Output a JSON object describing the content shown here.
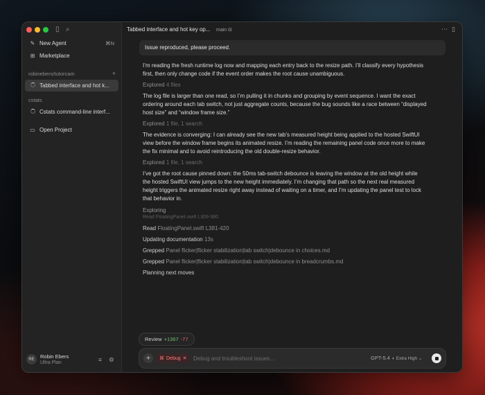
{
  "colors": {
    "traffic_red": "#ff5f57",
    "traffic_yellow": "#febc2e",
    "traffic_green": "#28c840",
    "diff_add": "#6fbf73",
    "diff_del": "#e06464",
    "debug_chip": "#ff7a7a"
  },
  "sidebar": {
    "toolbar_icons": [
      "sidebar-toggle-icon",
      "search-icon"
    ],
    "new_agent": {
      "label": "New Agent",
      "shortcut": "⌘N"
    },
    "marketplace": {
      "label": "Marketplace"
    },
    "sections": [
      {
        "name": "robinebers/tutorcam",
        "items": [
          {
            "label": "Tabbed interface and hot k..."
          }
        ]
      },
      {
        "name": "cstats",
        "items": [
          {
            "label": "Cstats command-line interf..."
          }
        ]
      }
    ],
    "open_project": {
      "label": "Open Project"
    },
    "user": {
      "initials": "RE",
      "name": "Robin Ebers",
      "plan": "Ultra Plan"
    }
  },
  "header": {
    "title": "Tabbed interface and hot key op...",
    "branch": "main"
  },
  "conversation": {
    "user_prompt": "Issue reproduced, please proceed.",
    "messages": [
      "I’m reading the fresh runtime log now and mapping each entry back to the resize path. I’ll classify every hypothesis first, then only change code if the event order makes the root cause unambiguous.",
      "The log file is larger than one read, so I’m pulling it in chunks and grouping by event sequence. I want the exact ordering around each tab switch, not just aggregate counts, because the bug sounds like a race between “displayed host size” and “window frame size.”",
      "The evidence is converging: I can already see the new tab’s measured height being applied to the hosted SwiftUI view before the window frame begins its animated resize. I’m reading the remaining panel code once more to make the fix minimal and to avoid reintroducing the old double-resize behavior.",
      "I’ve got the root cause pinned down: the 50ms tab-switch debounce is leaving the window at the old height while the hosted SwiftUI view jumps to the new height immediately. I’m changing that path so the next real measured height triggers the animated resize right away instead of waiting on a timer, and I’m updating the panel test to lock that behavior in."
    ],
    "explored": [
      {
        "verb": "Explored",
        "detail": "4 files"
      },
      {
        "verb": "Explored",
        "detail": "1 file, 1 search"
      },
      {
        "verb": "Explored",
        "detail": "1 file, 1 search"
      }
    ],
    "exploring_label": "Exploring",
    "faded_line": "Read FloatingPanel.swift L309-380",
    "activities": [
      {
        "verb": "Read",
        "detail": "FloatingPanel.swift L381-420"
      },
      {
        "verb": "Updating documentation",
        "detail": "13s"
      },
      {
        "verb": "Grepped",
        "detail": "Panel flicker|flicker stabilization|tab switch|debounce in choices.md"
      },
      {
        "verb": "Grepped",
        "detail": "Panel flicker|flicker stabilization|tab switch|debounce in breadcrumbs.md"
      },
      {
        "verb": "Planning next moves",
        "detail": ""
      }
    ]
  },
  "review": {
    "label": "Review",
    "additions": "+1367",
    "deletions": "-77"
  },
  "composer": {
    "mode_chip": "Debug",
    "placeholder": "Debug and troubleshoot issues...",
    "model": "GPT-5.4",
    "effort": "Extra High"
  }
}
